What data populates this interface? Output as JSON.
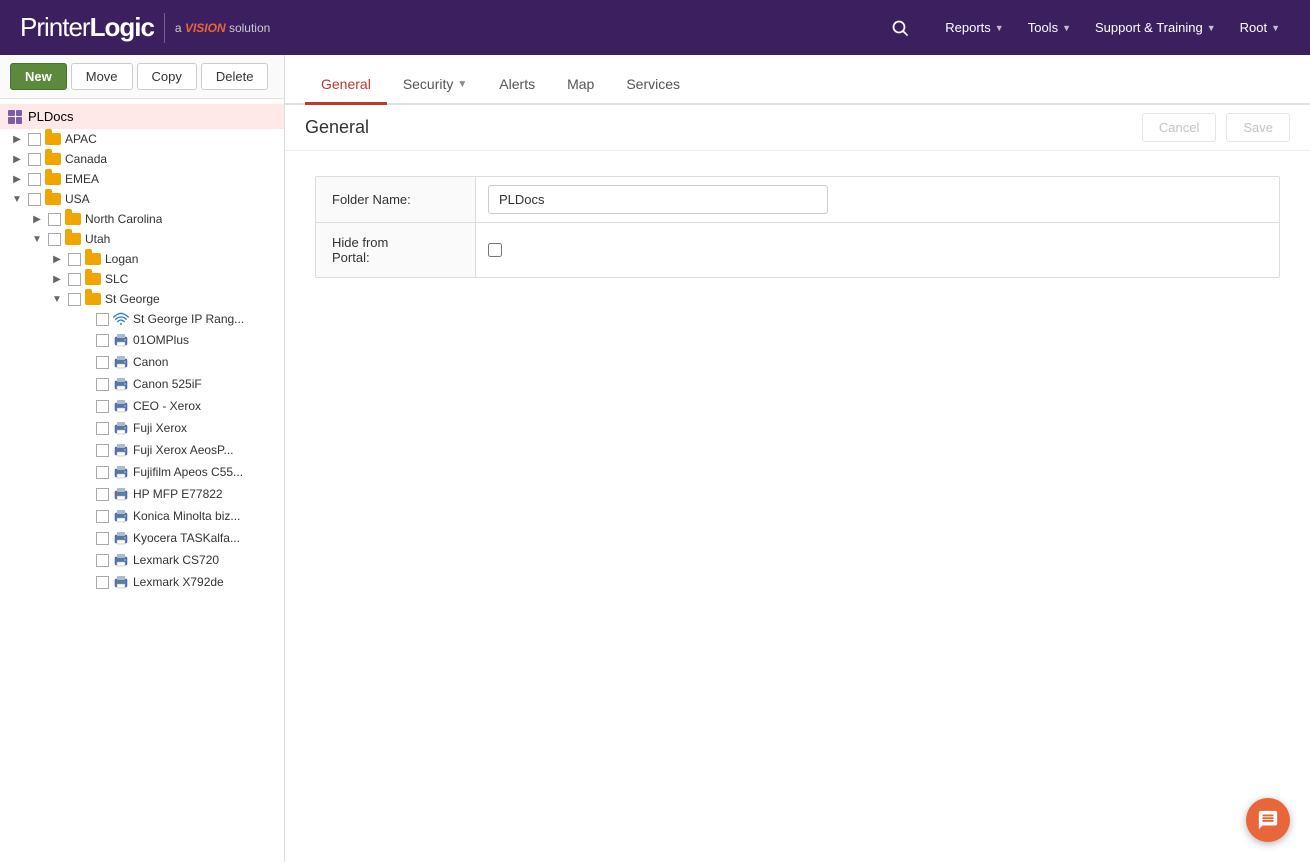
{
  "brand": {
    "name_printer": "Printer",
    "name_logic": "Logic",
    "separator": "a",
    "vision": "VISION",
    "solution": "solution"
  },
  "topnav": {
    "reports_label": "Reports",
    "tools_label": "Tools",
    "support_label": "Support & Training",
    "root_label": "Root"
  },
  "sidebar": {
    "root_label": "PLDocs",
    "new_btn": "New",
    "move_btn": "Move",
    "copy_btn": "Copy",
    "delete_btn": "Delete",
    "tree": [
      {
        "id": "apac",
        "label": "APAC",
        "type": "folder",
        "indent": 1,
        "toggle": "collapsed"
      },
      {
        "id": "canada",
        "label": "Canada",
        "type": "folder",
        "indent": 1,
        "toggle": "collapsed"
      },
      {
        "id": "emea",
        "label": "EMEA",
        "type": "folder",
        "indent": 1,
        "toggle": "collapsed"
      },
      {
        "id": "usa",
        "label": "USA",
        "type": "folder",
        "indent": 1,
        "toggle": "collapsed"
      },
      {
        "id": "north-carolina",
        "label": "North Carolina",
        "type": "folder",
        "indent": 2,
        "toggle": "collapsed"
      },
      {
        "id": "utah",
        "label": "Utah",
        "type": "folder",
        "indent": 2,
        "toggle": "expanded"
      },
      {
        "id": "logan",
        "label": "Logan",
        "type": "folder",
        "indent": 3,
        "toggle": "collapsed"
      },
      {
        "id": "slc",
        "label": "SLC",
        "type": "folder",
        "indent": 3,
        "toggle": "collapsed"
      },
      {
        "id": "st-george",
        "label": "St George",
        "type": "folder",
        "indent": 3,
        "toggle": "expanded"
      },
      {
        "id": "st-george-ip",
        "label": "St George IP Rang...",
        "type": "wifi",
        "indent": 4
      },
      {
        "id": "010mplus",
        "label": "01OMPlus",
        "type": "printer",
        "indent": 4
      },
      {
        "id": "canon",
        "label": "Canon",
        "type": "printer",
        "indent": 4
      },
      {
        "id": "canon525if",
        "label": "Canon 525iF",
        "type": "printer",
        "indent": 4
      },
      {
        "id": "ceo-xerox",
        "label": "CEO - Xerox",
        "type": "printer",
        "indent": 4
      },
      {
        "id": "fuji-xerox",
        "label": "Fuji Xerox",
        "type": "printer",
        "indent": 4
      },
      {
        "id": "fuji-xerox-apeos",
        "label": "Fuji Xerox AeosP...",
        "type": "printer",
        "indent": 4
      },
      {
        "id": "fujifilm-apeos",
        "label": "Fujifilm Apeos C55...",
        "type": "printer",
        "indent": 4
      },
      {
        "id": "hp-mfp",
        "label": "HP MFP E77822",
        "type": "printer-color",
        "indent": 4
      },
      {
        "id": "konica",
        "label": "Konica Minolta biz...",
        "type": "printer",
        "indent": 4
      },
      {
        "id": "kyocera",
        "label": "Kyocera TASKalfa...",
        "type": "printer",
        "indent": 4
      },
      {
        "id": "lexmark-cs720",
        "label": "Lexmark CS720",
        "type": "printer",
        "indent": 4
      },
      {
        "id": "lexmark-x792de",
        "label": "Lexmark X792de",
        "type": "printer-color",
        "indent": 4
      }
    ]
  },
  "tabs": [
    {
      "id": "general",
      "label": "General",
      "active": true
    },
    {
      "id": "security",
      "label": "Security",
      "has_arrow": true
    },
    {
      "id": "alerts",
      "label": "Alerts"
    },
    {
      "id": "map",
      "label": "Map"
    },
    {
      "id": "services",
      "label": "Services"
    }
  ],
  "content": {
    "title": "General",
    "cancel_btn": "Cancel",
    "save_btn": "Save",
    "form": {
      "folder_name_label": "Folder Name:",
      "folder_name_value": "PLDocs",
      "hide_portal_label": "Hide from\nPortal:",
      "hide_portal_checked": false
    }
  },
  "chat": {
    "icon": "chat-icon"
  }
}
